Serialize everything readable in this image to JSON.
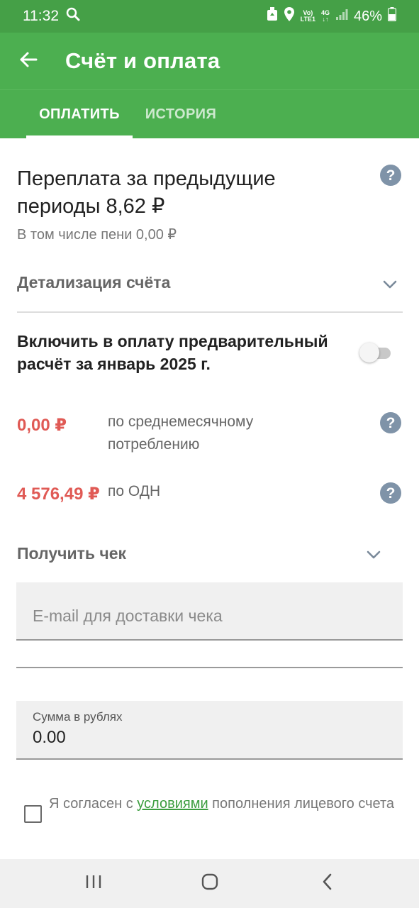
{
  "status_bar": {
    "time": "11:32",
    "net_top": "Vo)",
    "net_bottom": "LTE1",
    "net_type": "4G",
    "battery": "46%"
  },
  "app_bar": {
    "title": "Счёт и оплата",
    "back_icon": "arrow-left-icon"
  },
  "tabs": [
    {
      "label": "ОПЛАТИТЬ",
      "active": true
    },
    {
      "label": "ИСТОРИЯ",
      "active": false
    }
  ],
  "overpayment": {
    "title": "Переплата за предыдущие периоды 8,62 ₽",
    "penalty_note": "В том числе пени 0,00 ₽"
  },
  "details": {
    "label": "Детализация счёта"
  },
  "include_prepayment": {
    "label": "Включить в оплату предварительный расчёт за январь 2025 г.",
    "enabled": false
  },
  "charges": [
    {
      "amount": "0,00 ₽",
      "description": "по среднемесячному потреблению"
    },
    {
      "amount": "4 576,49 ₽",
      "description": "по ОДН"
    }
  ],
  "receipt": {
    "label": "Получить чек",
    "email_placeholder": "E-mail для доставки чека",
    "email_value": ""
  },
  "sum": {
    "label": "Сумма в рублях",
    "value": "0.00"
  },
  "agreement": {
    "prefix": "Я согласен с ",
    "link": "условиями",
    "suffix": " пополнения лицевого счета",
    "checked": false
  },
  "colors": {
    "status_bar": "#45a047",
    "primary": "#4caf50",
    "amount": "#e05a55",
    "help_icon": "#7f93a8",
    "link": "#3c9d3f"
  },
  "nav_icons": [
    "recent-apps-icon",
    "home-icon",
    "back-icon"
  ]
}
